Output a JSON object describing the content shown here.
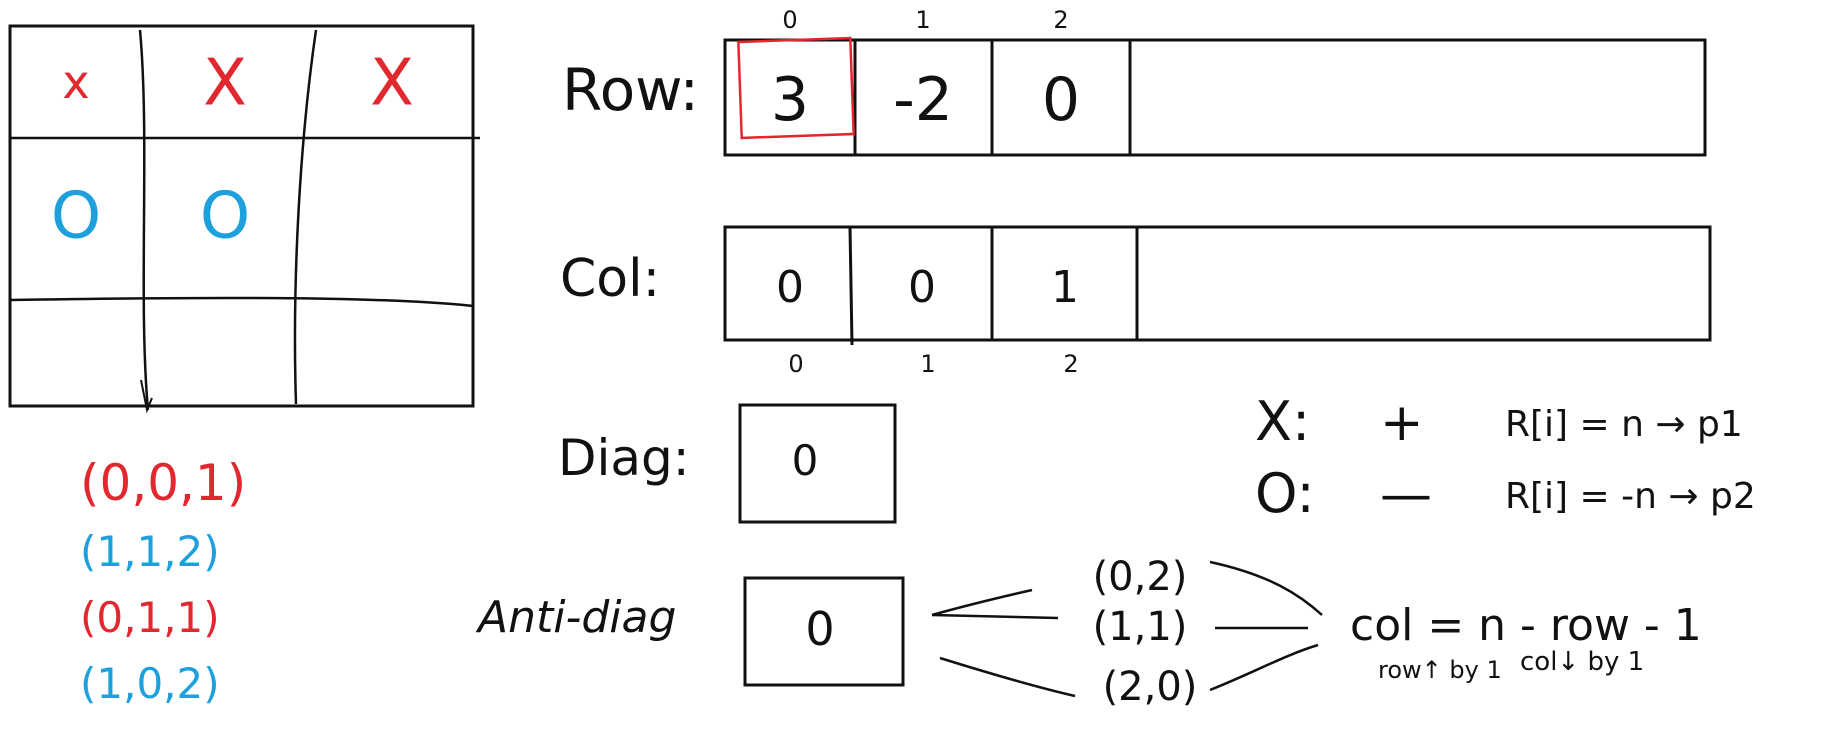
{
  "board": {
    "cells": [
      [
        "x",
        "X",
        "X"
      ],
      [
        "O",
        "O",
        ""
      ],
      [
        "",
        "",
        ""
      ]
    ],
    "colors": {
      "x": "#e0282e",
      "o": "#1ea0dc",
      "ink": "#111111"
    }
  },
  "moves": [
    {
      "text": "(0,0,1)",
      "player": "x"
    },
    {
      "text": "(1,1,2)",
      "player": "o"
    },
    {
      "text": "(0,1,1)",
      "player": "x"
    },
    {
      "text": "(1,0,2)",
      "player": "o"
    }
  ],
  "row": {
    "label": "Row:",
    "indices": [
      "0",
      "1",
      "2"
    ],
    "values": [
      "3",
      "-2",
      "0"
    ],
    "highlighted_index": 0
  },
  "col": {
    "label": "Col:",
    "indices": [
      "0",
      "1",
      "2"
    ],
    "values": [
      "0",
      "0",
      "1"
    ]
  },
  "diag": {
    "label": "Diag:",
    "value": "0"
  },
  "anti_diag": {
    "label": "Anti-diag",
    "value": "0",
    "coords": [
      "(0,2)",
      "(1,1)",
      "(2,0)"
    ],
    "formula": "col = n - row - 1",
    "note_row": "row↑ by 1",
    "note_col": "col↓ by 1"
  },
  "rules": [
    {
      "player": "X:",
      "op": "+",
      "condition": "R[i] = n → p1"
    },
    {
      "player": "O:",
      "op": "—",
      "condition": "R[i] = -n → p2"
    }
  ]
}
